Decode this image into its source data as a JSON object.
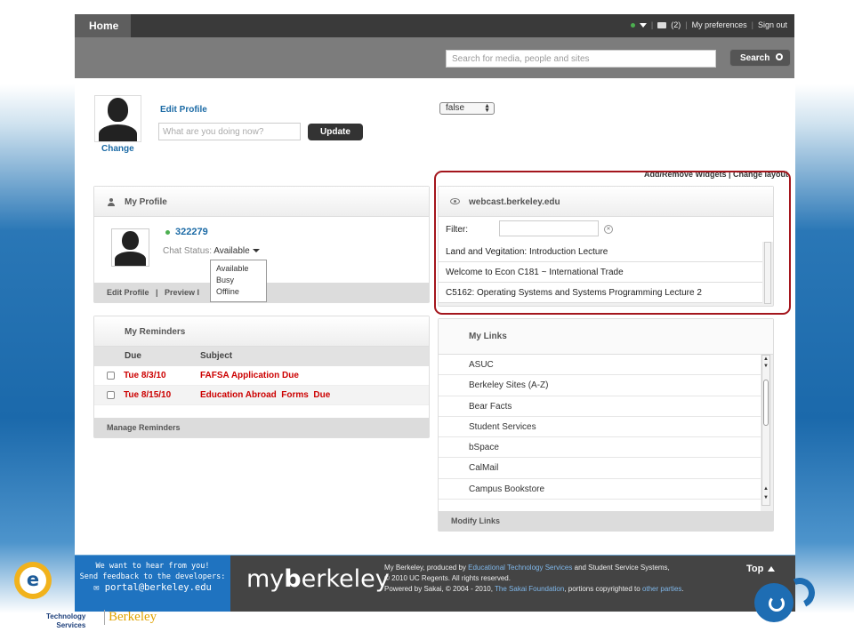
{
  "topbar": {
    "home_tab": "Home",
    "messages": "(2)",
    "preferences": "My preferences",
    "signout": "Sign out"
  },
  "search": {
    "placeholder": "Search for media, people and sites",
    "button": "Search"
  },
  "status_update": {
    "edit_profile": "Edit Profile",
    "change": "Change",
    "placeholder": "What are you doing now?",
    "update_button": "Update",
    "select_value": "false"
  },
  "layout_links": "Add/Remove Widgets | Change layout",
  "my_profile": {
    "title": "My Profile",
    "user_id": "322279",
    "chat_status_label": "Chat Status:",
    "chat_status_value": "Available",
    "chat_options": [
      "Available",
      "Busy",
      "Offline"
    ],
    "footer": "Edit Profile   |   Preview I"
  },
  "reminders": {
    "title": "My Reminders",
    "columns": [
      "Due",
      "Subject"
    ],
    "rows": [
      {
        "due": "Tue 8/3/10",
        "subject": "FAFSA Application Due"
      },
      {
        "due": "Tue 8/15/10",
        "subject": "Education Abroad  Forms  Due"
      }
    ],
    "footer": "Manage Reminders"
  },
  "webcast": {
    "title": "webcast.berkeley.edu",
    "filter_label": "Filter:",
    "items": [
      "Land and Vegitation: Introduction Lecture",
      "Welcome to Econ C181 ~ International Trade",
      "C5162: Operating Systems and Systems Programming Lecture 2"
    ]
  },
  "my_links": {
    "title": "My Links",
    "items": [
      "ASUC",
      "Berkeley Sites (A-Z)",
      "Bear Facts",
      "Student Services",
      "bSpace",
      "CalMail",
      "Campus Bookstore"
    ],
    "footer": "Modify Links"
  },
  "footer": {
    "feedback_line1": "We want to hear from you!",
    "feedback_line2": "Send feedback to the developers:",
    "feedback_email": "portal@berkeley.edu",
    "logo_prefix": "my",
    "logo_bold": "b",
    "logo_suffix": "erkeley",
    "info_line1_a": "My Berkeley, produced by ",
    "info_line1_link": "Educational Technology Services",
    "info_line1_b": " and Student Service Systems,",
    "info_line2": "© 2010 UC Regents. All rights reserved.",
    "info_line3_a": "Powered by Sakai, © 2004 - 2010, ",
    "info_line3_link": "The Sakai Foundation",
    "info_line3_b": ", portions copyrighted to ",
    "info_line3_link2": "other parties",
    "info_line3_c": ".",
    "top_link": "Top"
  },
  "branding": {
    "ets_letter": "e",
    "tech_line1": "Technology",
    "tech_line2": "Services",
    "berkeley": "Berkeley"
  },
  "colors": {
    "accent": "#1b6aa5",
    "alert_red": "#cc0000",
    "highlight_outline": "#a4161d",
    "footer_blue": "#1f73c0"
  }
}
